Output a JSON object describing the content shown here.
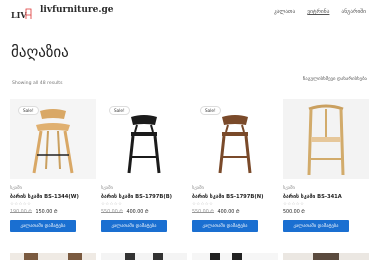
{
  "header": {
    "logo_mark": "LIV",
    "site_name": "livfurniture.ge",
    "nav": [
      "კალათა",
      "ვიტრინა",
      "ანგარიში"
    ]
  },
  "page": {
    "title": "მაღაზია",
    "results": "Showing all 48 results",
    "sort": "ნაგულისხმევი დახარისხება"
  },
  "products": [
    {
      "sale": "Sale!",
      "category": "სკამი",
      "name": "ბარის სკამი BS-1344(W)",
      "stars": "☆☆☆☆☆",
      "old_price": "190.00 ₾",
      "price": "150.00 ₾",
      "button": "კალათაში დამატება"
    },
    {
      "sale": "Sale!",
      "category": "სკამი",
      "name": "ბარის სკამი BS-1797B(B)",
      "stars": "☆☆☆☆☆",
      "old_price": "550.00 ₾",
      "price": "400.00 ₾",
      "button": "კალათაში დამატება"
    },
    {
      "sale": "Sale!",
      "category": "სკამი",
      "name": "ბარის სკამი BS-1797B(N)",
      "stars": "☆☆☆☆☆",
      "old_price": "550.00 ₾",
      "price": "400.00 ₾",
      "button": "კალათაში დამატება"
    },
    {
      "sale": "",
      "category": "სკამი",
      "name": "ბარის სკამი BS-341A",
      "stars": "☆☆☆☆☆",
      "old_price": "",
      "price": "500.00 ₾",
      "button": "კალათაში დამატება"
    }
  ],
  "colors": {
    "accent": "#1a6fd1",
    "sale_badge_border": "#dddddd"
  }
}
